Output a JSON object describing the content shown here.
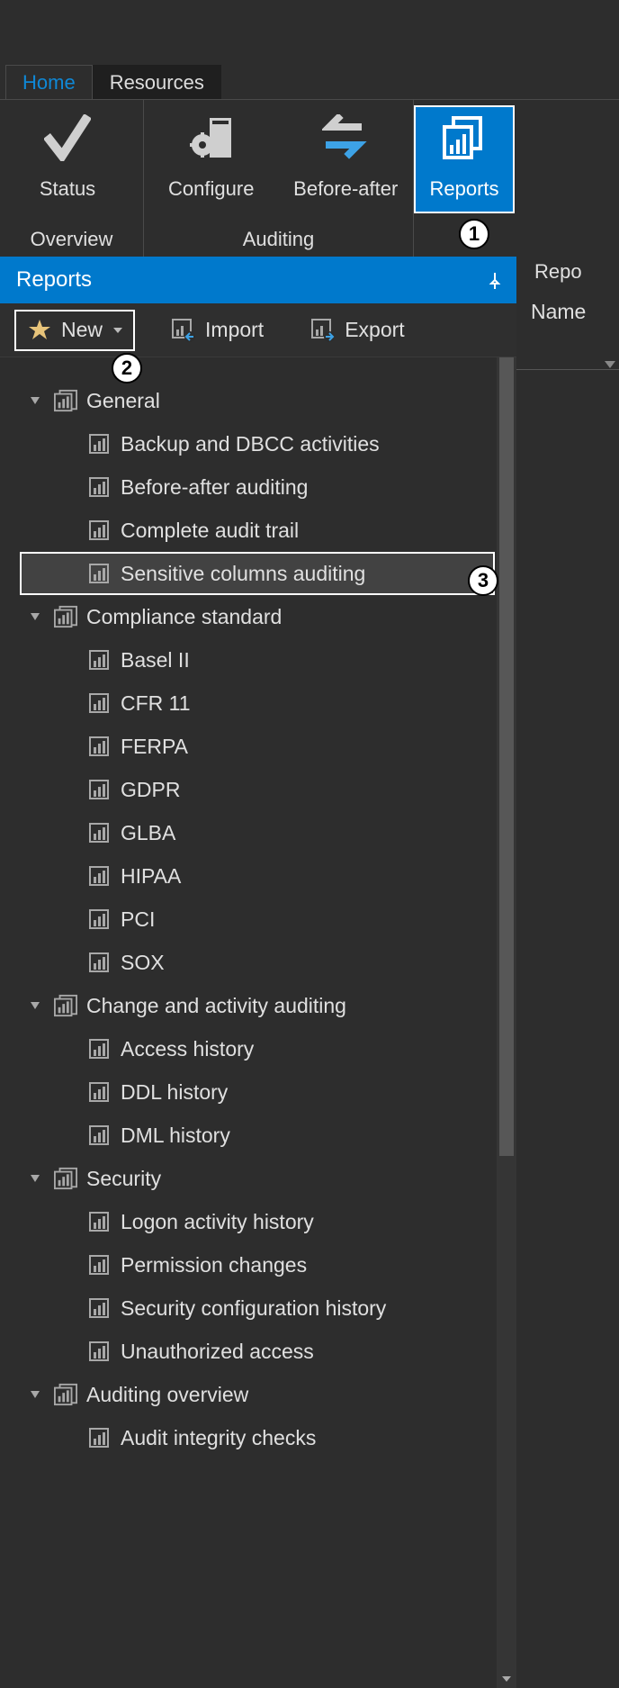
{
  "tabs": {
    "home": "Home",
    "resources": "Resources"
  },
  "ribbon": {
    "overview_group": "Overview",
    "auditing_group": "Auditing",
    "reports_group_clipped": "Repo",
    "status": "Status",
    "configure": "Configure",
    "before_after": "Before-after",
    "reports": "Reports"
  },
  "panel": {
    "title": "Reports",
    "new": "New",
    "import": "Import",
    "export": "Export"
  },
  "right": {
    "name": "Name"
  },
  "callouts": {
    "c1": "1",
    "c2": "2",
    "c3": "3"
  },
  "tree": {
    "groups": [
      {
        "label": "General",
        "items": [
          "Backup and DBCC activities",
          "Before-after auditing",
          "Complete audit trail",
          "Sensitive columns auditing"
        ]
      },
      {
        "label": "Compliance standard",
        "items": [
          "Basel II",
          "CFR 11",
          "FERPA",
          "GDPR",
          "GLBA",
          "HIPAA",
          "PCI",
          "SOX"
        ]
      },
      {
        "label": "Change and activity auditing",
        "items": [
          "Access history",
          "DDL history",
          "DML history"
        ]
      },
      {
        "label": "Security",
        "items": [
          "Logon activity history",
          "Permission changes",
          "Security configuration history",
          "Unauthorized access"
        ]
      },
      {
        "label": "Auditing overview",
        "items": [
          "Audit integrity checks"
        ]
      }
    ],
    "selected": "Sensitive columns auditing"
  }
}
